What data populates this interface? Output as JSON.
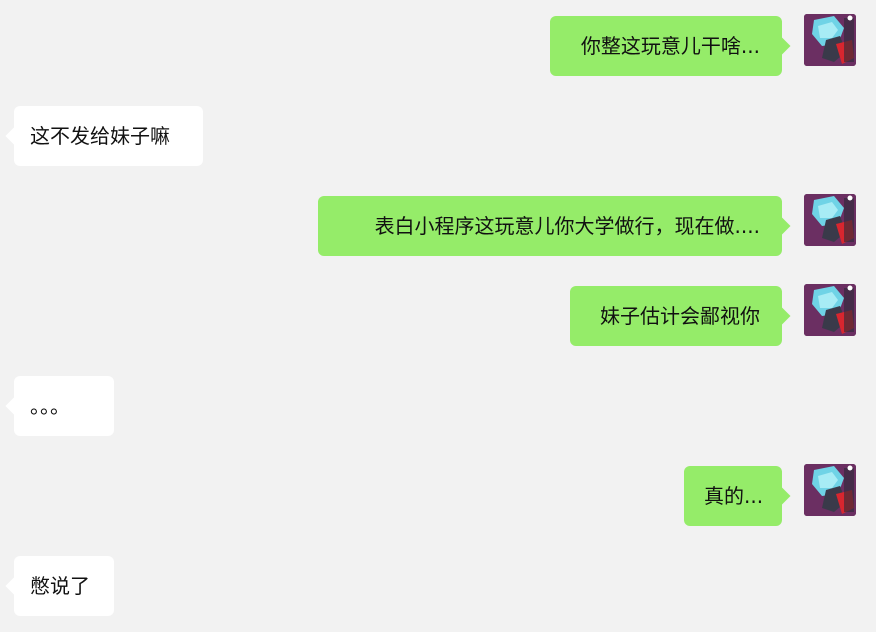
{
  "messages": [
    {
      "side": "right",
      "text": "你整这玩意儿干啥..."
    },
    {
      "side": "left",
      "text": "这不发给妹子嘛"
    },
    {
      "side": "right",
      "text": "表白小程序这玩意儿你大学做行，现在做...."
    },
    {
      "side": "right",
      "text": "妹子估计会鄙视你"
    },
    {
      "side": "left",
      "text": "。。。"
    },
    {
      "side": "right",
      "text": "真的..."
    },
    {
      "side": "left",
      "text": "憋说了"
    }
  ],
  "colors": {
    "background": "#f2f2f2",
    "outgoing_bubble": "#95ec69",
    "incoming_bubble": "#ffffff",
    "avatar_bg": "#6b2f62"
  },
  "icons": {
    "avatar": "cartoon-robot-avatar"
  }
}
